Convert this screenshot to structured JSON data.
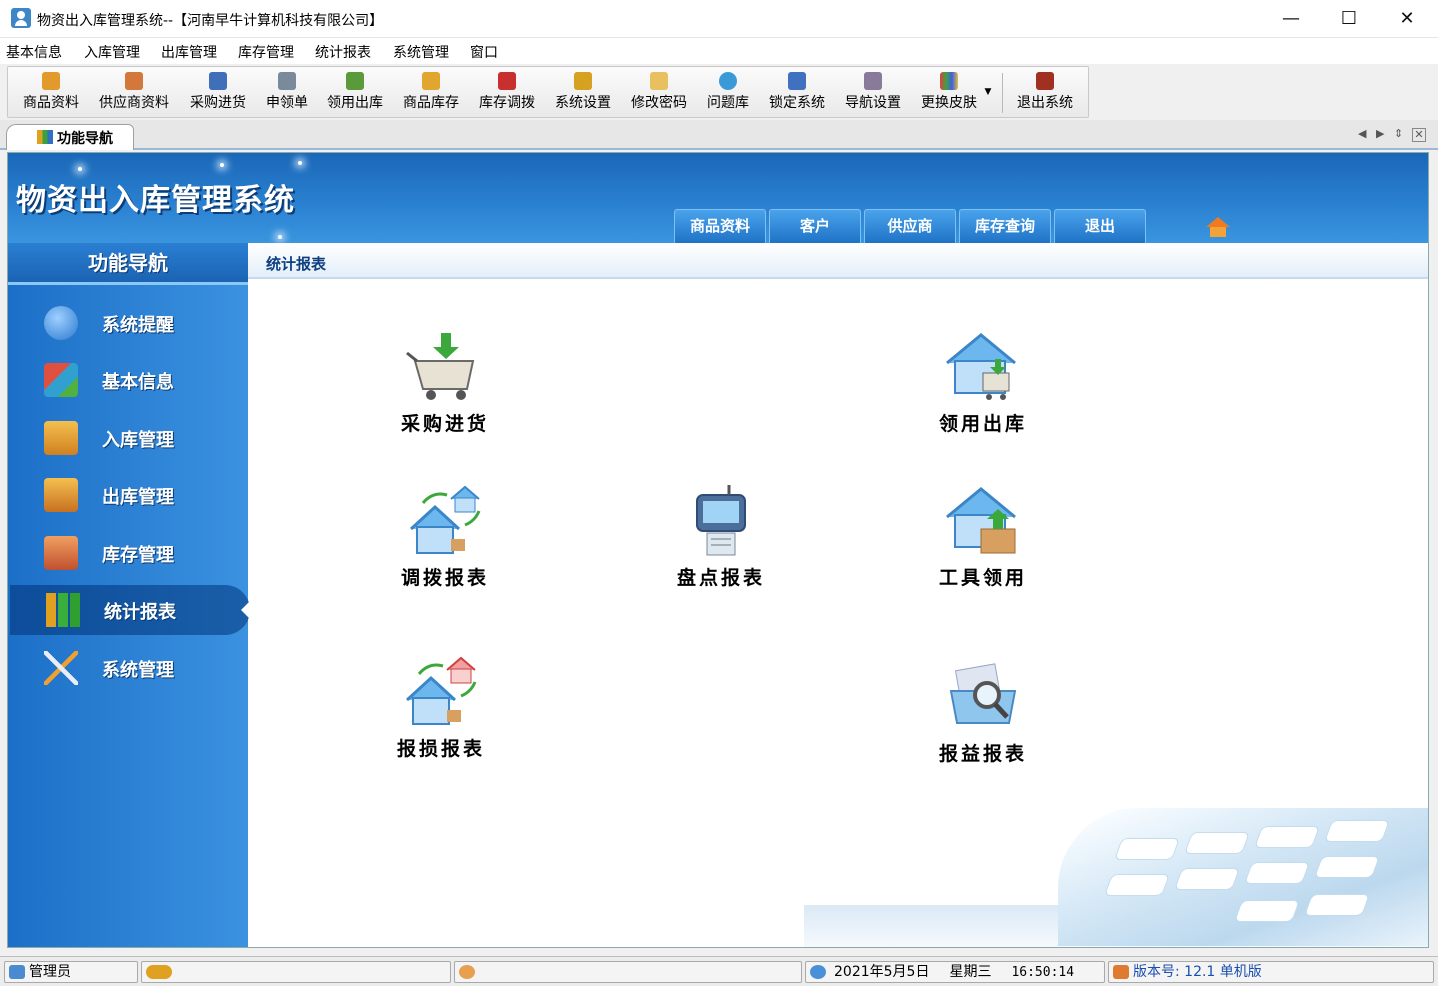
{
  "window": {
    "title": "物资出入库管理系统--【河南早牛计算机科技有限公司】",
    "minimize": "—",
    "maximize": "☐",
    "close": "✕"
  },
  "menu": [
    "基本信息",
    "入库管理",
    "出库管理",
    "库存管理",
    "统计报表",
    "系统管理",
    "窗口"
  ],
  "toolbar": [
    {
      "label": "商品资料",
      "icon": "goods-icon",
      "color": "#e39a2d"
    },
    {
      "label": "供应商资料",
      "icon": "supplier-icon",
      "color": "#d3783a"
    },
    {
      "label": "采购进货",
      "icon": "truck-icon",
      "color": "#3f6fb8"
    },
    {
      "label": "申领单",
      "icon": "printer-icon",
      "color": "#7a8a9a"
    },
    {
      "label": "领用出库",
      "icon": "cart-icon",
      "color": "#5a9a3a"
    },
    {
      "label": "商品库存",
      "icon": "box-icon",
      "color": "#e0a630"
    },
    {
      "label": "库存调拨",
      "icon": "transfer-icon",
      "color": "#c83030"
    },
    {
      "label": "系统设置",
      "icon": "settings-icon",
      "color": "#d6a020"
    },
    {
      "label": "修改密码",
      "icon": "key-icon",
      "color": "#e8c060"
    },
    {
      "label": "问题库",
      "icon": "question-icon",
      "color": "#3a9ad8"
    },
    {
      "label": "锁定系统",
      "icon": "lock-icon",
      "color": "#4070c0"
    },
    {
      "label": "导航设置",
      "icon": "nav-icon",
      "color": "#8a7a9a"
    },
    {
      "label": "更换皮肤",
      "icon": "palette-icon",
      "color": "#c040a0"
    },
    {
      "label": "退出系统",
      "icon": "exit-icon",
      "color": "#a03020"
    }
  ],
  "tab": {
    "label": "功能导航"
  },
  "banner": {
    "title": "物资出入库管理系统",
    "tabs": [
      "商品资料",
      "客户",
      "供应商",
      "库存查询",
      "退出"
    ]
  },
  "sidebar": {
    "header": "功能导航",
    "items": [
      {
        "label": "系统提醒",
        "icon": "info-icon",
        "color": "#3d8be0"
      },
      {
        "label": "基本信息",
        "icon": "cubes-icon",
        "color": "#d04030"
      },
      {
        "label": "入库管理",
        "icon": "inbox-icon",
        "color": "#e8a030"
      },
      {
        "label": "出库管理",
        "icon": "outbox-icon",
        "color": "#e8a030"
      },
      {
        "label": "库存管理",
        "icon": "warehouse-icon",
        "color": "#e07a40"
      },
      {
        "label": "统计报表",
        "icon": "bar-chart-icon",
        "color": "#3fae3f"
      },
      {
        "label": "系统管理",
        "icon": "tools-icon",
        "color": "#c8d0d8"
      }
    ]
  },
  "content": {
    "heading": "统计报表",
    "functions": [
      {
        "label": "采购进货",
        "icon": "cart-icon"
      },
      {
        "label": "领用出库",
        "icon": "house-cart-icon"
      },
      {
        "label": "调拨报表",
        "icon": "house-transfer-icon"
      },
      {
        "label": "盘点报表",
        "icon": "scanner-icon"
      },
      {
        "label": "工具领用",
        "icon": "house-box-icon"
      },
      {
        "label": "报损报表",
        "icon": "house-damage-icon"
      },
      {
        "label": "报益报表",
        "icon": "folder-search-icon"
      }
    ]
  },
  "status": {
    "user": "管理员",
    "date": "2021年5月5日",
    "weekday": "星期三",
    "time": "16:50:14",
    "version": "版本号: 12.1 单机版"
  }
}
